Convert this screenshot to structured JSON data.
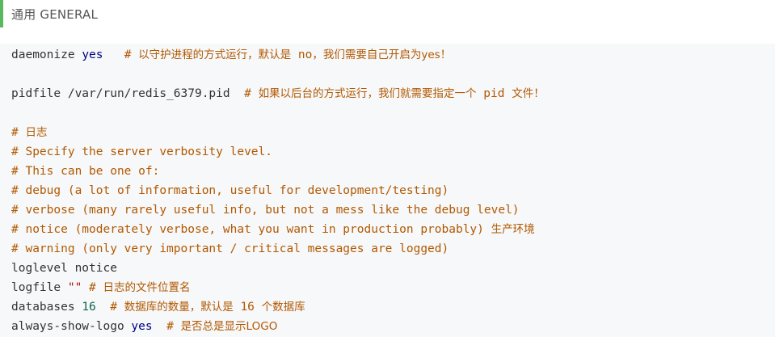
{
  "section": {
    "heading": "通用 GENERAL",
    "accent_color": "#5cb85c"
  },
  "code": {
    "line1": {
      "key": "daemonize",
      "value": "yes",
      "comment_prefix": "# ",
      "comment_cn": "以守护进程的方式运行，默认是",
      "comment_code": "no",
      "comment_cn2": "，我们需要自己开启为yes！"
    },
    "line2": {
      "text": "pidfile /var/run/redis_6379.pid",
      "comment_prefix": "# ",
      "comment_cn": "如果以后台的方式运行，我们就需要指定一个",
      "comment_code": "pid",
      "comment_cn2": "文件！"
    },
    "line3": {
      "comment_prefix": "# ",
      "comment_cn": "日志"
    },
    "line4": "# Specify the server verbosity level.",
    "line5": "# This can be one of:",
    "line6": "# debug (a lot of information, useful for development/testing)",
    "line7": "# verbose (many rarely useful info, but not a mess like the debug level)",
    "line8": {
      "comment": "# notice (moderately verbose, what you want in production probably)",
      "comment_cn": "生产环境"
    },
    "line9": "# warning (only very important / critical messages are logged)",
    "line10": "loglevel notice",
    "line11": {
      "key": "logfile",
      "value": "\"\"",
      "comment_prefix": "# ",
      "comment_cn": "日志的文件位置名"
    },
    "line12": {
      "key": "databases",
      "value": "16",
      "comment_prefix": "# ",
      "comment_cn": "数据库的数量，默认是",
      "comment_code": "16",
      "comment_cn2": "个数据库"
    },
    "line13": {
      "key": "always-show-logo",
      "value": "yes",
      "comment_prefix": "# ",
      "comment_cn": "是否总是显示LOGO"
    }
  }
}
